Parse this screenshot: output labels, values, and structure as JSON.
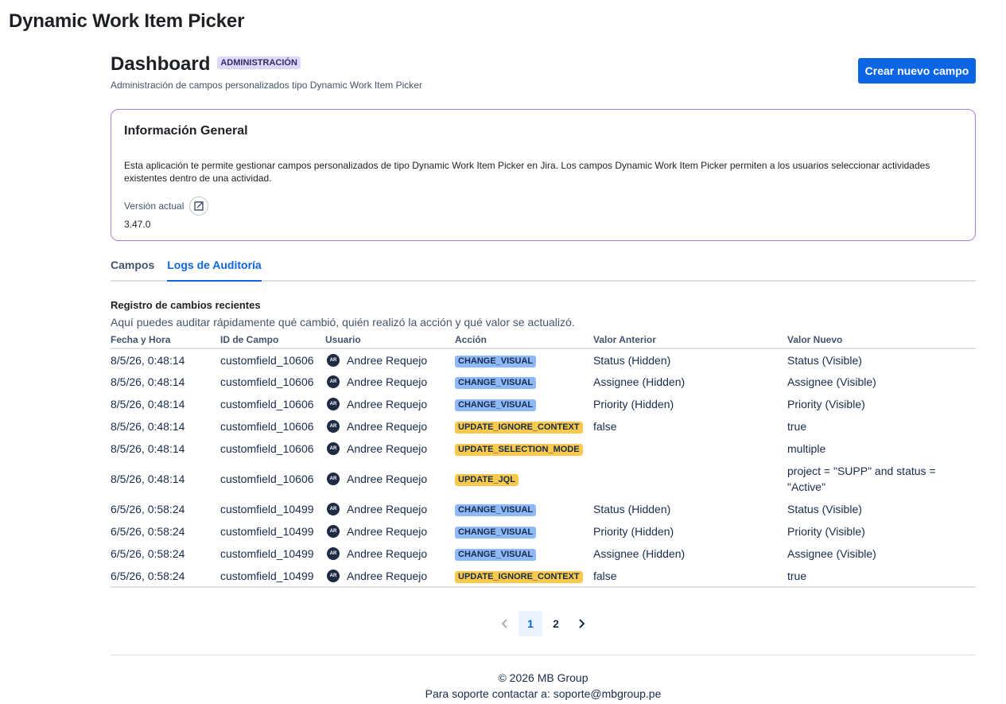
{
  "app": {
    "title": "Dynamic Work Item Picker"
  },
  "header": {
    "title": "Dashboard",
    "badge": "ADMINISTRACIÓN",
    "subtitle": "Administración de campos personalizados tipo Dynamic Work Item Picker",
    "create_button": "Crear nuevo campo"
  },
  "info": {
    "title": "Información General",
    "text": "Esta aplicación te permite gestionar campos personalizados de tipo Dynamic Work Item Picker en Jira. Los campos Dynamic Work Item Picker permiten a los usuarios seleccionar actividades existentes dentro de una actividad.",
    "version_label": "Versión actual",
    "version_value": "3.47.0",
    "version_icon": "external-link-icon"
  },
  "tabs": [
    {
      "label": "Campos",
      "active": false
    },
    {
      "label": "Logs de Auditoría",
      "active": true
    }
  ],
  "audit": {
    "title": "Registro de cambios recientes",
    "description": "Aquí puedes auditar rápidamente qué cambió, quién realizó la acción y qué valor se actualizó.",
    "columns": [
      "Fecha y Hora",
      "ID de Campo",
      "Usuario",
      "Acción",
      "Valor Anterior",
      "Valor Nuevo"
    ],
    "rows": [
      {
        "date": "8/5/26, 0:48:14",
        "field": "customfield_10606",
        "initials": "AR",
        "user": "Andree Requejo",
        "action": "CHANGE_VISUAL",
        "action_color": "#8fb8f6",
        "old": "Status (Hidden)",
        "new": "Status (Visible)"
      },
      {
        "date": "8/5/26, 0:48:14",
        "field": "customfield_10606",
        "initials": "AR",
        "user": "Andree Requejo",
        "action": "CHANGE_VISUAL",
        "action_color": "#8fb8f6",
        "old": "Assignee (Hidden)",
        "new": "Assignee (Visible)"
      },
      {
        "date": "8/5/26, 0:48:14",
        "field": "customfield_10606",
        "initials": "AR",
        "user": "Andree Requejo",
        "action": "CHANGE_VISUAL",
        "action_color": "#8fb8f6",
        "old": "Priority (Hidden)",
        "new": "Priority (Visible)"
      },
      {
        "date": "8/5/26, 0:48:14",
        "field": "customfield_10606",
        "initials": "AR",
        "user": "Andree Requejo",
        "action": "UPDATE_IGNORE_CONTEXT",
        "action_color": "#f8c94c",
        "old": "false",
        "new": "true"
      },
      {
        "date": "8/5/26, 0:48:14",
        "field": "customfield_10606",
        "initials": "AR",
        "user": "Andree Requejo",
        "action": "UPDATE_SELECTION_MODE",
        "action_color": "#f8c94c",
        "old": "",
        "new": "multiple"
      },
      {
        "date": "8/5/26, 0:48:14",
        "field": "customfield_10606",
        "initials": "AR",
        "user": "Andree Requejo",
        "action": "UPDATE_JQL",
        "action_color": "#f8c94c",
        "old": "",
        "new": "project = \"SUPP\" and status = \"Active\""
      },
      {
        "date": "6/5/26, 0:58:24",
        "field": "customfield_10499",
        "initials": "AR",
        "user": "Andree Requejo",
        "action": "CHANGE_VISUAL",
        "action_color": "#8fb8f6",
        "old": "Status (Hidden)",
        "new": "Status (Visible)"
      },
      {
        "date": "6/5/26, 0:58:24",
        "field": "customfield_10499",
        "initials": "AR",
        "user": "Andree Requejo",
        "action": "CHANGE_VISUAL",
        "action_color": "#8fb8f6",
        "old": "Priority (Hidden)",
        "new": "Priority (Visible)"
      },
      {
        "date": "6/5/26, 0:58:24",
        "field": "customfield_10499",
        "initials": "AR",
        "user": "Andree Requejo",
        "action": "CHANGE_VISUAL",
        "action_color": "#8fb8f6",
        "old": "Assignee (Hidden)",
        "new": "Assignee (Visible)"
      },
      {
        "date": "6/5/26, 0:58:24",
        "field": "customfield_10499",
        "initials": "AR",
        "user": "Andree Requejo",
        "action": "UPDATE_IGNORE_CONTEXT",
        "action_color": "#f8c94c",
        "old": "false",
        "new": "true"
      }
    ]
  },
  "pagination": {
    "prev_icon": "chevron-left-icon",
    "next_icon": "chevron-right-icon",
    "pages": [
      "1",
      "2"
    ],
    "current": "1"
  },
  "footer": {
    "copyright": "© 2026 MB Group",
    "support": "Para soporte contactar a: soporte@mbgroup.pe"
  }
}
